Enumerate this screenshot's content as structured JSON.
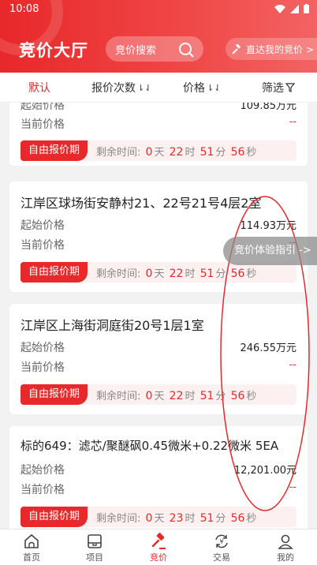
{
  "status": {
    "time": "10:08"
  },
  "header": {
    "title": "竞价大厅",
    "search_placeholder": "竞价搜索",
    "my_bid": "直达我的竞价 >"
  },
  "filters": [
    {
      "label": "默认",
      "suffix": ""
    },
    {
      "label": "报价次数",
      "suffix": "⇂⇃"
    },
    {
      "label": "价格",
      "suffix": "⇂⇃"
    },
    {
      "label": "筛选",
      "suffix": ""
    }
  ],
  "common": {
    "start_label": "起始价格",
    "current_label": "当前价格",
    "bid_tag": "自由报价期",
    "remain_label": "剩余时间:",
    "unit_day": "天",
    "unit_hour": "时",
    "unit_min": "分",
    "unit_sec": "秒"
  },
  "items": [
    {
      "title": "",
      "start_price": "109.85万元",
      "current_price": "--",
      "days": "0",
      "hours": "22",
      "mins": "51",
      "secs": "56"
    },
    {
      "title": "江岸区球场街安静村21、22号21号4层2室",
      "start_price": "114.93万元",
      "current_price": "--",
      "days": "0",
      "hours": "22",
      "mins": "51",
      "secs": "56"
    },
    {
      "title": "江岸区上海街洞庭街20号1层1室",
      "start_price": "246.55万元",
      "current_price": "--",
      "days": "0",
      "hours": "22",
      "mins": "51",
      "secs": "56"
    },
    {
      "title": "标的649：滤芯/聚醚砜0.45微米+0.22微米 5EA",
      "start_price": "12,201.00元",
      "current_price": "--",
      "days": "0",
      "hours": "23",
      "mins": "51",
      "secs": "56"
    }
  ],
  "guide": "竞价体验指引 ->",
  "nav": [
    {
      "label": "首页",
      "icon": "home-icon"
    },
    {
      "label": "项目",
      "icon": "project-icon"
    },
    {
      "label": "竞价",
      "icon": "gavel-icon"
    },
    {
      "label": "交易",
      "icon": "exchange-icon"
    },
    {
      "label": "我的",
      "icon": "user-icon"
    }
  ],
  "colors": {
    "accent": "#e8282a",
    "bid_bg": "#fdf0f0"
  }
}
